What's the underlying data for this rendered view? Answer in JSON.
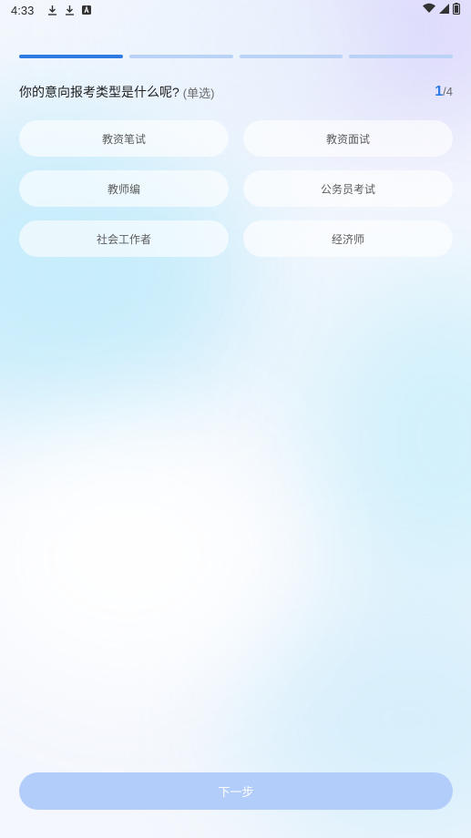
{
  "status_bar": {
    "time": "4:33",
    "icons": [
      "download-icon",
      "download-icon",
      "a-icon"
    ],
    "right_icons": [
      "wifi-icon",
      "signal-icon",
      "battery-icon"
    ]
  },
  "progress": {
    "total_steps": 4,
    "current_step": 1
  },
  "question": {
    "text": "你的意向报考类型是什么呢?",
    "type_label": "(单选)",
    "current": "1",
    "total": "/4"
  },
  "options": [
    {
      "label": "教资笔试"
    },
    {
      "label": "教资面试"
    },
    {
      "label": "教师编"
    },
    {
      "label": "公务员考试"
    },
    {
      "label": "社会工作者"
    },
    {
      "label": "经济师"
    }
  ],
  "next_button": {
    "label": "下一步",
    "enabled": false
  },
  "colors": {
    "accent": "#2f7be4",
    "progress_inactive": "#b9d2f6",
    "button_disabled": "#b3cdfb"
  }
}
